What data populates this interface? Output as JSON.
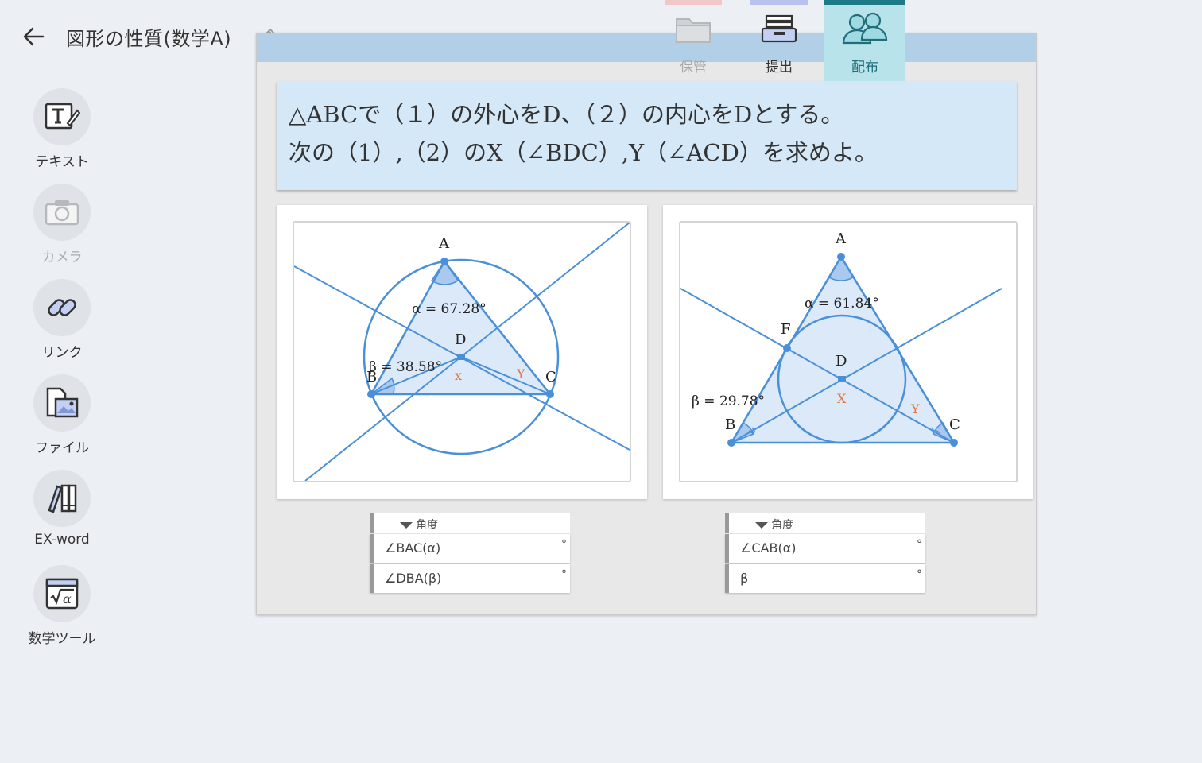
{
  "header": {
    "title": "図形の性質(数学A)"
  },
  "tools": [
    {
      "label": "テキスト",
      "icon": "text-edit-icon"
    },
    {
      "label": "カメラ",
      "icon": "camera-icon"
    },
    {
      "label": "リンク",
      "icon": "link-icon"
    },
    {
      "label": "ファイル",
      "icon": "file-image-icon"
    },
    {
      "label": "EX-word",
      "icon": "dictionary-icon"
    },
    {
      "label": "数学ツール",
      "icon": "sqrt-alpha-icon"
    }
  ],
  "tabs": [
    {
      "label": "保管",
      "icon": "folder-icon"
    },
    {
      "label": "提出",
      "icon": "tray-icon"
    },
    {
      "label": "配布",
      "icon": "users-icon"
    }
  ],
  "question": {
    "line1": "△ABCで（１）の外心をD、（２）の内心をDとする。",
    "line2": "次の（1）,（2）のX（∠BDC）,Y（∠ACD）を求めよ。"
  },
  "figure1": {
    "point_A": "A",
    "point_B": "B",
    "point_C": "C",
    "point_D": "D",
    "alpha": "α = 67.28°",
    "beta": "β = 38.58°",
    "x": "x",
    "y": "Y"
  },
  "figure2": {
    "point_A": "A",
    "point_B": "B",
    "point_C": "C",
    "point_D": "D",
    "point_F": "F",
    "alpha": "α = 61.84°",
    "beta": "β = 29.78°",
    "x": "X",
    "y": "Y"
  },
  "table1": {
    "header": "角度",
    "row1": "∠BAC(α)",
    "row2": "∠DBA(β)",
    "unit": "°"
  },
  "table2": {
    "header": "角度",
    "row1": "∠CAB(α)",
    "row2": "β",
    "unit": "°"
  },
  "colors": {
    "line": "#4a90d9",
    "fill": "#dbe9f8",
    "label_orange": "#e8733a",
    "accent_tab": "#1f7a87"
  }
}
